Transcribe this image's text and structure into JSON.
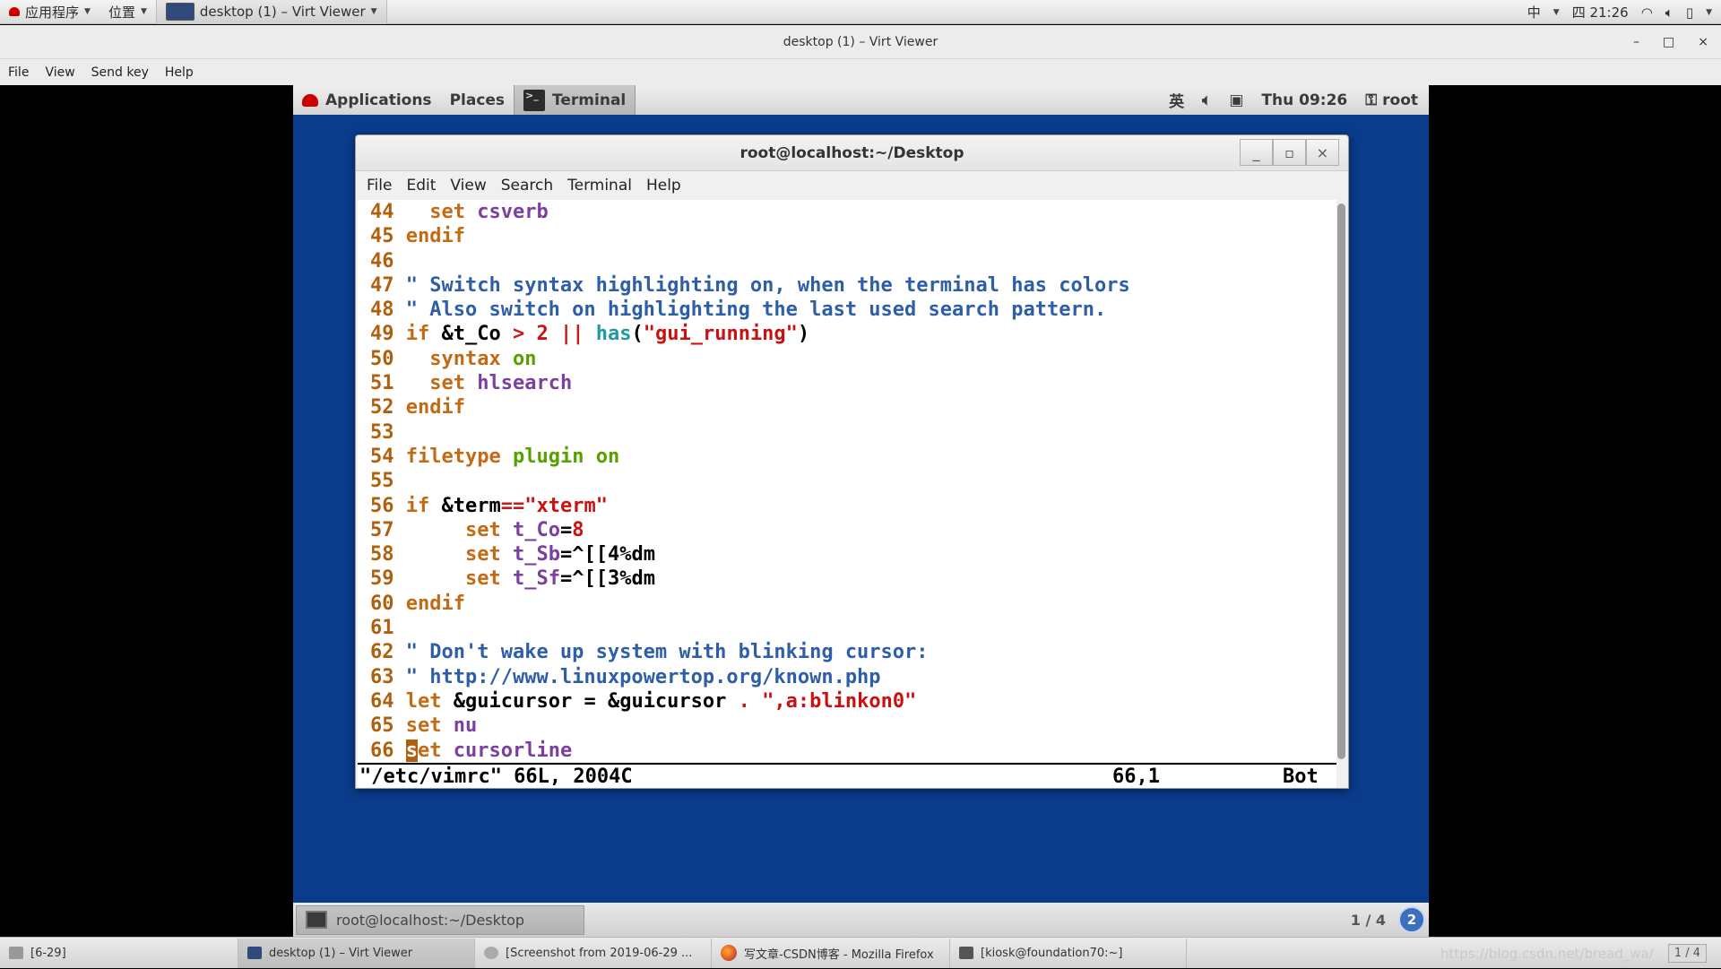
{
  "host_top": {
    "apps_label": "应用程序",
    "places_label": "位置",
    "task_label": "desktop (1) – Virt Viewer",
    "input_method": "中",
    "clock": "四 21:26"
  },
  "viewer": {
    "title": "desktop (1) – Virt Viewer",
    "menu": [
      "File",
      "View",
      "Send key",
      "Help"
    ],
    "ctrl_min": "–",
    "ctrl_max": "□",
    "ctrl_close": "×"
  },
  "guest_top": {
    "applications": "Applications",
    "places": "Places",
    "terminal": "Terminal",
    "lang": "英",
    "clock": "Thu 09:26",
    "user": "root"
  },
  "terminal": {
    "title": "root@localhost:~/Desktop",
    "menu": [
      "File",
      "Edit",
      "View",
      "Search",
      "Terminal",
      "Help"
    ],
    "lines": [
      {
        "n": "44",
        "text": "   set csverb"
      },
      {
        "n": "45",
        "text": " endif"
      },
      {
        "n": "46",
        "text": ""
      },
      {
        "n": "47",
        "text": " \" Switch syntax highlighting on, when the terminal has colors"
      },
      {
        "n": "48",
        "text": " \" Also switch on highlighting the last used search pattern."
      },
      {
        "n": "49",
        "text": " if &t_Co > 2 || has(\"gui_running\")"
      },
      {
        "n": "50",
        "text": "   syntax on"
      },
      {
        "n": "51",
        "text": "   set hlsearch"
      },
      {
        "n": "52",
        "text": " endif"
      },
      {
        "n": "53",
        "text": ""
      },
      {
        "n": "54",
        "text": " filetype plugin on"
      },
      {
        "n": "55",
        "text": ""
      },
      {
        "n": "56",
        "text": " if &term==\"xterm\""
      },
      {
        "n": "57",
        "text": "      set t_Co=8"
      },
      {
        "n": "58",
        "text": "      set t_Sb=^[[4%dm"
      },
      {
        "n": "59",
        "text": "      set t_Sf=^[[3%dm"
      },
      {
        "n": "60",
        "text": " endif"
      },
      {
        "n": "61",
        "text": ""
      },
      {
        "n": "62",
        "text": " \" Don't wake up system with blinking cursor:"
      },
      {
        "n": "63",
        "text": " \" http://www.linuxpowertop.org/known.php"
      },
      {
        "n": "64",
        "text": " let &guicursor = &guicursor . \",a:blinkon0\""
      },
      {
        "n": "65",
        "text": " set nu"
      },
      {
        "n": "66",
        "text": " set cursorline"
      }
    ],
    "status_file": "\"/etc/vimrc\" 66L, 2004C",
    "status_pos": "66,1",
    "status_scroll": "Bot"
  },
  "guest_bottom": {
    "task": "root@localhost:~/Desktop",
    "pager": "1 / 4",
    "workspace": "2"
  },
  "host_taskbar": {
    "items": [
      "[6-29]",
      "desktop (1) – Virt Viewer",
      "[Screenshot from 2019-06-29 ...",
      "写文章-CSDN博客 - Mozilla Firefox",
      "[kiosk@foundation70:~]"
    ],
    "watermark": "https://blog.csdn.net/bread_wa/",
    "pager": "1 / 4"
  }
}
